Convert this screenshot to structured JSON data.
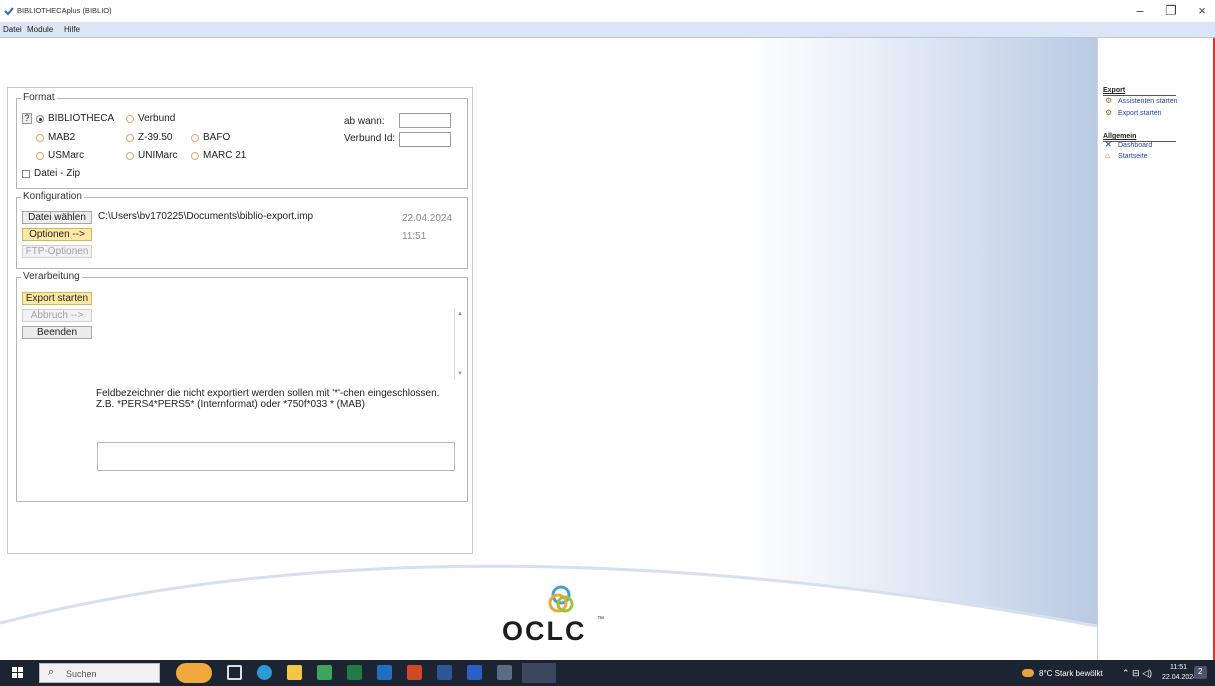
{
  "window": {
    "title": "BIBLIOTHECAplus (BIBLIO)",
    "minimize": "–",
    "maximize": "❐",
    "close": "×"
  },
  "menu": [
    "Datei",
    "Module",
    "Hilfe"
  ],
  "format": {
    "legend": "Format",
    "help": "?",
    "radios": [
      {
        "label": "BIBLIOTHECA",
        "checked": true
      },
      {
        "label": "Verbund",
        "checked": false
      },
      {
        "label": "MAB2",
        "checked": false
      },
      {
        "label": "Z-39.50",
        "checked": false
      },
      {
        "label": "BAFO",
        "checked": false
      },
      {
        "label": "USMarc",
        "checked": false
      },
      {
        "label": "UNIMarc",
        "checked": false
      },
      {
        "label": "MARC 21",
        "checked": false
      }
    ],
    "zip_label": "Datei - Zip",
    "ab_wann_label": "ab wann:",
    "ab_wann_value": "",
    "verbund_id_label": "Verbund Id:",
    "verbund_id_value": ""
  },
  "konfiguration": {
    "legend": "Konfiguration",
    "datei_waehlen": "Datei wählen",
    "path": "C:\\Users\\bv170225\\Documents\\biblio-export.imp",
    "date": "22.04.2024",
    "time": "11:51",
    "optionen": "Optionen -->",
    "ftp_optionen": "FTP-Optionen"
  },
  "verarbeitung": {
    "legend": "Verarbeitung",
    "export_starten": "Export starten",
    "abbruch": "Abbruch  -->",
    "beenden": "Beenden",
    "hint_line1": "Feldbezeichner die nicht exportiert werden sollen mit '*'-chen eingeschlossen.",
    "hint_line2": "Z.B. *PERS4*PERS5* (Internformat) oder *750f*033 * (MAB)",
    "field_value": ""
  },
  "logo": {
    "text": "OCLC",
    "tm": "™"
  },
  "right_panel": {
    "export_heading": "Export",
    "export_links": [
      {
        "label": "Assistenten starten",
        "icon": "wizard-icon"
      },
      {
        "label": "Export starten",
        "icon": "export-icon"
      }
    ],
    "allgemein_heading": "Allgemein",
    "allgemein_links": [
      {
        "label": "Dashboard",
        "icon": "dashboard-icon"
      },
      {
        "label": "Startseite",
        "icon": "home-icon"
      }
    ]
  },
  "taskbar": {
    "search_placeholder": "Suchen",
    "weather": "8°C  Stark bewölkt",
    "time": "11:51",
    "date": "22.04.2024",
    "notifications": "2"
  },
  "colors": {
    "menu_bg": "#dbe5f3",
    "button_yellow": "#fde9a6",
    "link_blue": "#2348a5",
    "taskbar": "#1c2331"
  }
}
